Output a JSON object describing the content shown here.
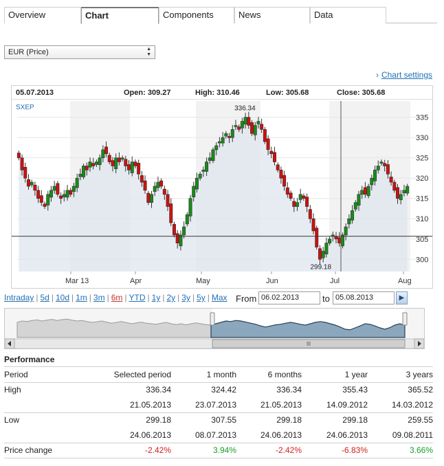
{
  "tabs": [
    {
      "label": "Overview",
      "active": false
    },
    {
      "label": "Chart",
      "active": true
    },
    {
      "label": "Components",
      "active": false
    },
    {
      "label": "News",
      "active": false
    },
    {
      "label": "Data",
      "active": false
    }
  ],
  "currency_select": {
    "value": "EUR (Price)"
  },
  "chart_settings_link": "Chart settings",
  "info_bar": {
    "date": "05.07.2013",
    "open": "Open: 309.27",
    "high": "High: 310.46",
    "low": "Low: 305.68",
    "close": "Close: 305.68"
  },
  "symbol": "SXEP",
  "colors": {
    "up": "#1a8a1a",
    "down": "#cc1111",
    "area": "#dfe5ef",
    "band": "#f2f2f2",
    "nav_area": "#8aa7bd",
    "link": "#1f6fb5"
  },
  "chart_data": {
    "type": "candlestick",
    "series_label": "SXEP",
    "x_ticks": [
      "Mar 13",
      "Apr",
      "May",
      "Jun",
      "Jul",
      "Aug"
    ],
    "y_ticks": [
      300,
      305,
      310,
      315,
      320,
      325,
      330,
      335
    ],
    "ylim": [
      297,
      339
    ],
    "max_label": "336.34",
    "min_label": "299.18",
    "reference_line": 305.68,
    "crosshair_date": "05.07.2013",
    "closes": [
      325,
      322,
      320,
      318,
      319,
      317,
      315,
      314,
      313,
      316,
      317,
      318,
      316,
      315,
      316,
      317,
      316,
      318,
      320,
      321,
      323,
      322,
      324,
      323,
      324,
      325,
      327,
      326,
      324,
      323,
      325,
      324,
      325,
      323,
      322,
      324,
      323,
      321,
      319,
      317,
      314,
      316,
      318,
      319,
      318,
      316,
      313,
      309,
      306,
      304,
      306,
      308,
      311,
      315,
      318,
      320,
      321,
      322,
      324,
      325,
      327,
      328,
      329,
      330,
      331,
      330,
      332,
      333,
      332,
      334,
      335,
      333,
      331,
      333,
      334,
      332,
      329,
      327,
      326,
      324,
      322,
      320,
      318,
      316,
      315,
      313,
      314,
      316,
      315,
      313,
      310,
      307,
      303,
      300,
      302,
      304,
      305,
      306,
      305,
      304,
      306,
      308,
      310,
      312,
      314,
      316,
      317,
      316,
      318,
      320,
      322,
      323,
      324,
      323,
      321,
      319,
      317,
      315,
      316,
      317,
      318
    ]
  },
  "range_links": [
    "Intraday",
    "5d",
    "10d",
    "1m",
    "3m",
    "6m",
    "YTD",
    "1y",
    "2y",
    "3y",
    "5y",
    "Max"
  ],
  "active_range": "6m",
  "date_range": {
    "from_label": "From",
    "from": "06.02.2013",
    "to_label": "to",
    "to": "05.08.2013"
  },
  "navigator": {
    "values": [
      0.55,
      0.6,
      0.58,
      0.62,
      0.64,
      0.6,
      0.63,
      0.66,
      0.62,
      0.65,
      0.67,
      0.63,
      0.6,
      0.62,
      0.58,
      0.55,
      0.57,
      0.6,
      0.56,
      0.52,
      0.55,
      0.58,
      0.54,
      0.5,
      0.53,
      0.56,
      0.52,
      0.5,
      0.48,
      0.52,
      0.55,
      0.5,
      0.47,
      0.5,
      0.46,
      0.5,
      0.53,
      0.5,
      0.47,
      0.45,
      0.5,
      0.55,
      0.6,
      0.58,
      0.62,
      0.6,
      0.56,
      0.52,
      0.48,
      0.42,
      0.38,
      0.42,
      0.46,
      0.48,
      0.52,
      0.55,
      0.52,
      0.48,
      0.45,
      0.5,
      0.55,
      0.58,
      0.55,
      0.5,
      0.45,
      0.38,
      0.3,
      0.28,
      0.35,
      0.42,
      0.5,
      0.48,
      0.42,
      0.35,
      0.3,
      0.36,
      0.45,
      0.5,
      0.44
    ]
  },
  "performance": {
    "title": "Performance",
    "columns": [
      "Period",
      "Selected period",
      "1 month",
      "6 months",
      "1 year",
      "3 years"
    ],
    "rows": [
      {
        "label": "High",
        "values": [
          "336.34",
          "324.42",
          "336.34",
          "355.43",
          "365.52"
        ],
        "dates": [
          "21.05.2013",
          "23.07.2013",
          "21.05.2013",
          "14.09.2012",
          "14.03.2012"
        ]
      },
      {
        "label": "Low",
        "values": [
          "299.18",
          "307.55",
          "299.18",
          "299.18",
          "259.55"
        ],
        "dates": [
          "24.06.2013",
          "08.07.2013",
          "24.06.2013",
          "24.06.2013",
          "09.08.2011"
        ]
      },
      {
        "label": "Price change",
        "values": [
          "-2.42%",
          "3.94%",
          "-2.42%",
          "-6.83%",
          "3.66%"
        ]
      }
    ]
  }
}
